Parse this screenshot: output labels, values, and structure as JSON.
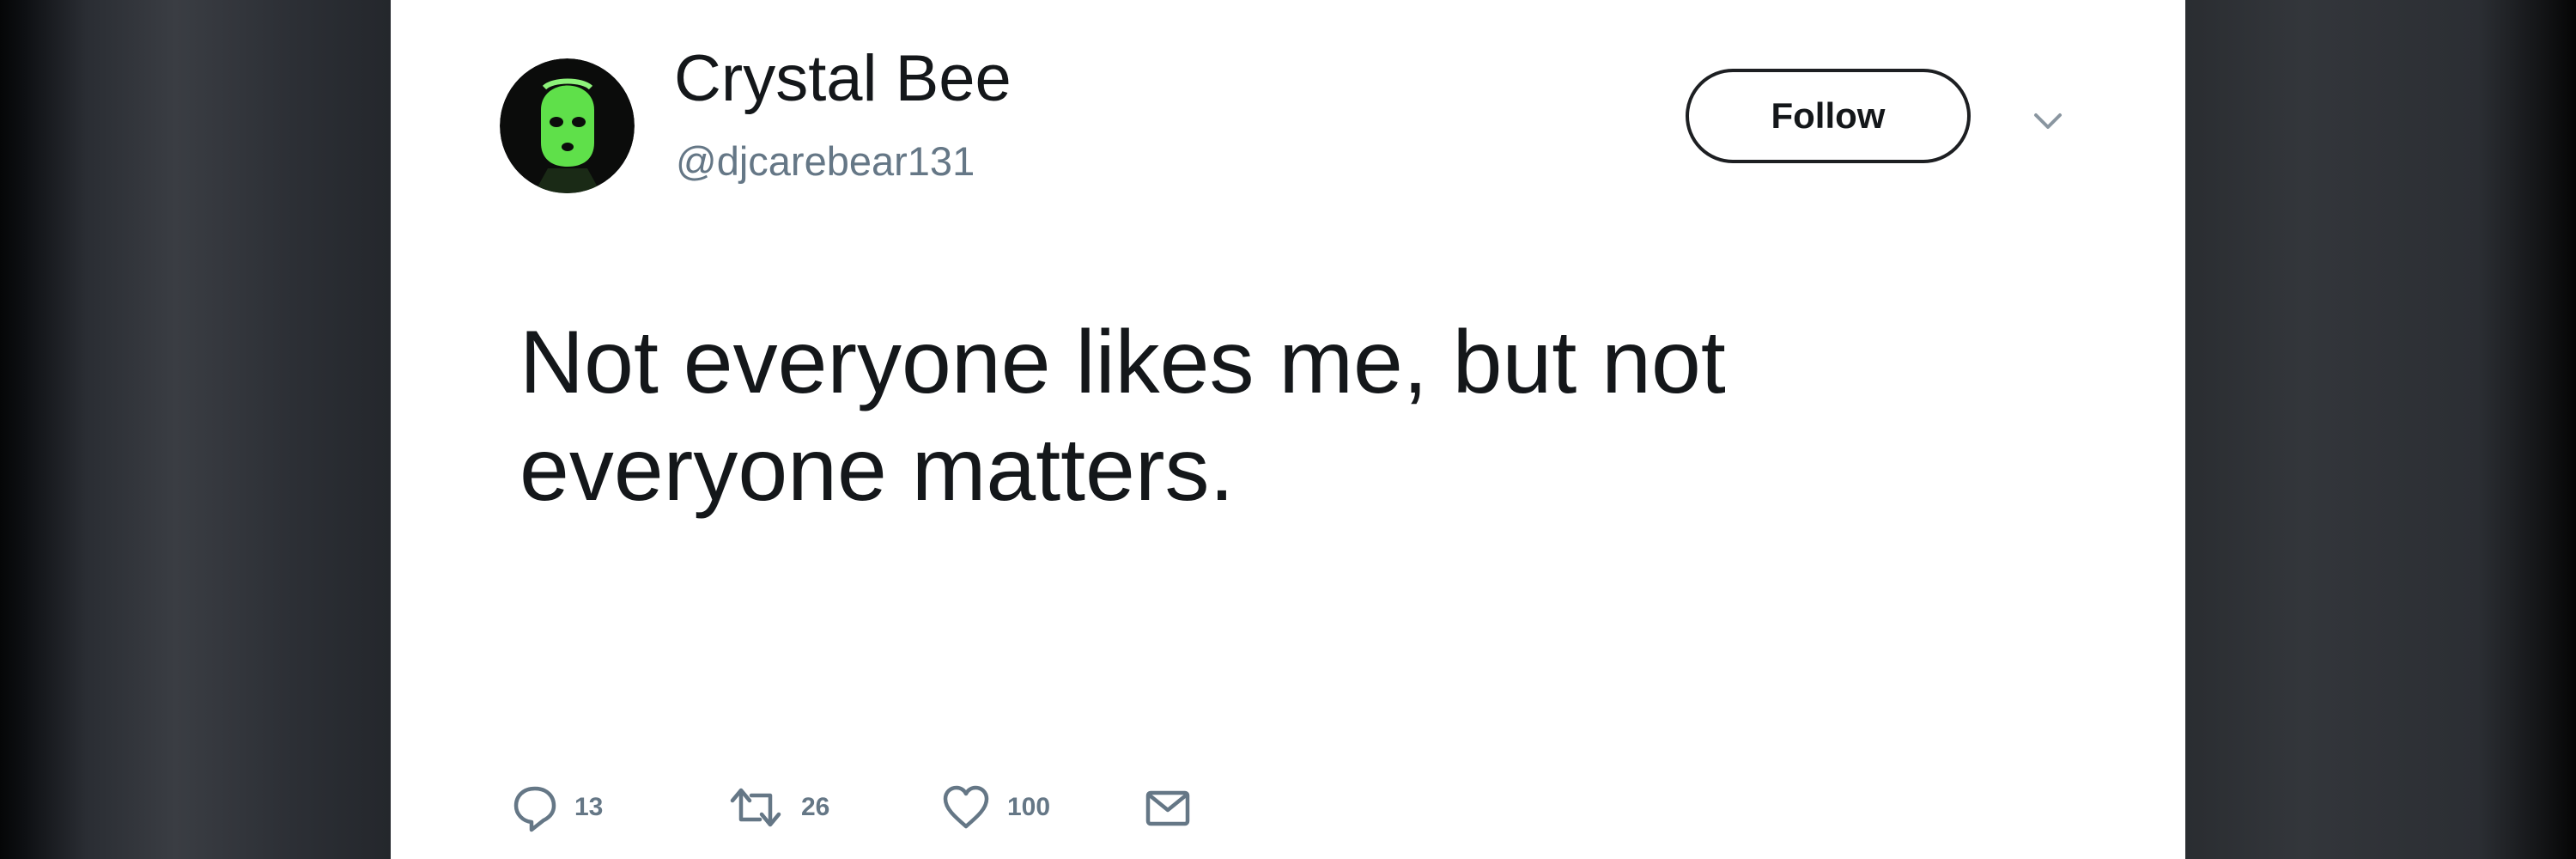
{
  "tweet": {
    "author": {
      "display_name": "Crystal Bee",
      "handle": "@djcarebear131"
    },
    "follow_label": "Follow",
    "text": "Not everyone likes me, but not everyone matters.",
    "stats": {
      "replies": "13",
      "retweets": "26",
      "likes": "100"
    }
  },
  "colors": {
    "name_text": "#14171a",
    "secondary_text": "#657786",
    "avatar_mask": "#5fe04a",
    "card_background": "#ffffff"
  },
  "icons": {
    "reply": "reply-icon",
    "retweet": "retweet-icon",
    "like": "heart-icon",
    "message": "envelope-icon",
    "more": "chevron-down-icon"
  }
}
